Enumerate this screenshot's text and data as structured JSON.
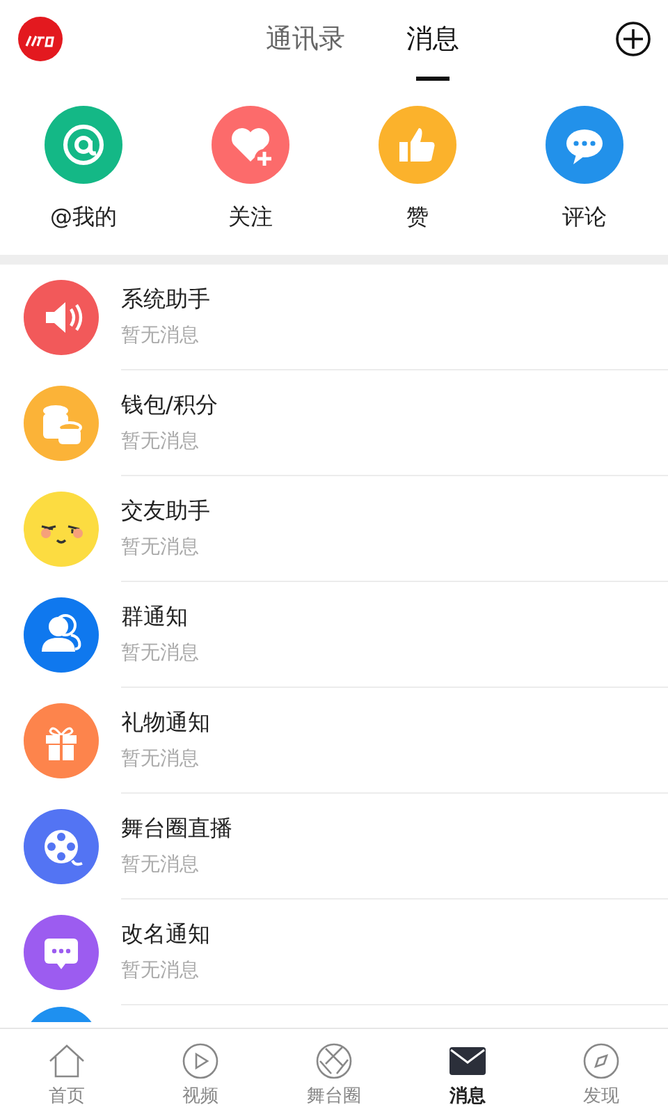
{
  "header": {
    "tabs": [
      {
        "label": "通讯录",
        "selected": false
      },
      {
        "label": "消息",
        "selected": true
      }
    ]
  },
  "quick_actions": [
    {
      "label": "@我的",
      "kind": "at",
      "color": "#14b886"
    },
    {
      "label": "关注",
      "kind": "follow",
      "color": "#fc6b6b"
    },
    {
      "label": "赞",
      "kind": "like",
      "color": "#fbb22c"
    },
    {
      "label": "评论",
      "kind": "comment",
      "color": "#2291ea"
    }
  ],
  "messages": [
    {
      "title": "系统助手",
      "preview": "暂无消息",
      "kind": "speaker",
      "color": "#f2595a"
    },
    {
      "title": "钱包/积分",
      "preview": "暂无消息",
      "kind": "coins",
      "color": "#fbb338"
    },
    {
      "title": "交友助手",
      "preview": "暂无消息",
      "kind": "face",
      "color": "#fcdc41"
    },
    {
      "title": "群通知",
      "preview": "暂无消息",
      "kind": "people",
      "color": "#0f78ee"
    },
    {
      "title": "礼物通知",
      "preview": "暂无消息",
      "kind": "gift",
      "color": "#fd844c"
    },
    {
      "title": "舞台圈直播",
      "preview": "暂无消息",
      "kind": "film",
      "color": "#5374f3"
    },
    {
      "title": "改名通知",
      "preview": "暂无消息",
      "kind": "chat",
      "color": "#9c5cf0"
    },
    {
      "kind": "partial",
      "color": "#1e90f0"
    }
  ],
  "bottom_nav": [
    {
      "label": "首页",
      "kind": "home",
      "selected": false
    },
    {
      "label": "视频",
      "kind": "video",
      "selected": false
    },
    {
      "label": "舞台圈",
      "kind": "stage",
      "selected": false
    },
    {
      "label": "消息",
      "kind": "mail",
      "selected": true
    },
    {
      "label": "发现",
      "kind": "discover",
      "selected": false
    }
  ]
}
